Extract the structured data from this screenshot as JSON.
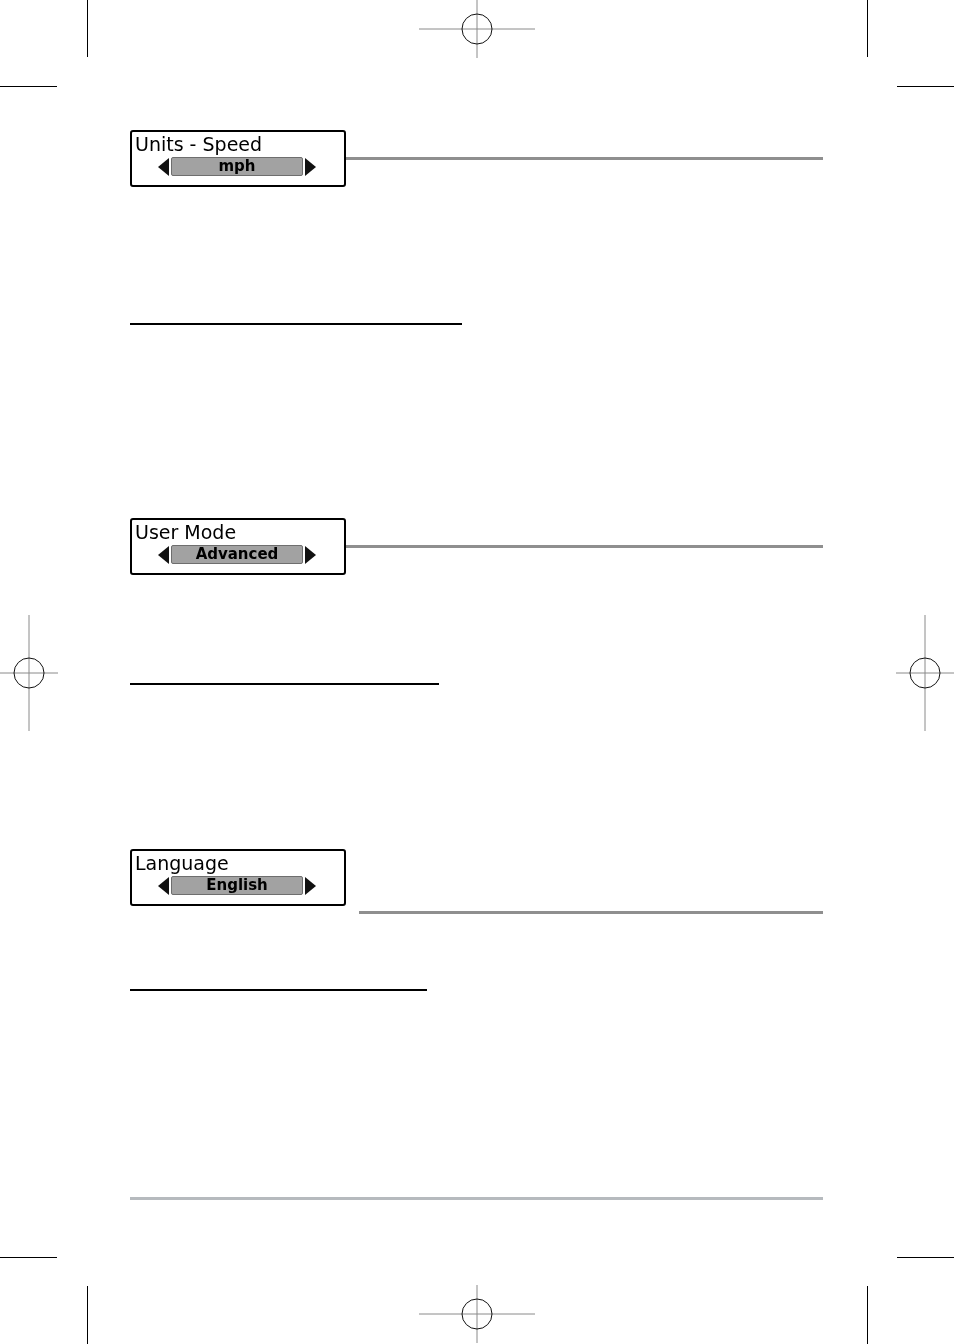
{
  "sections": [
    {
      "kind": "rule_beside",
      "menu": {
        "title": "Units - Speed",
        "value": "mph"
      }
    },
    {
      "kind": "rule_beside",
      "menu": {
        "title": "User Mode",
        "value": "Advanced"
      }
    },
    {
      "kind": "rule_below",
      "menu": {
        "title": "Language",
        "value": "English"
      }
    }
  ]
}
